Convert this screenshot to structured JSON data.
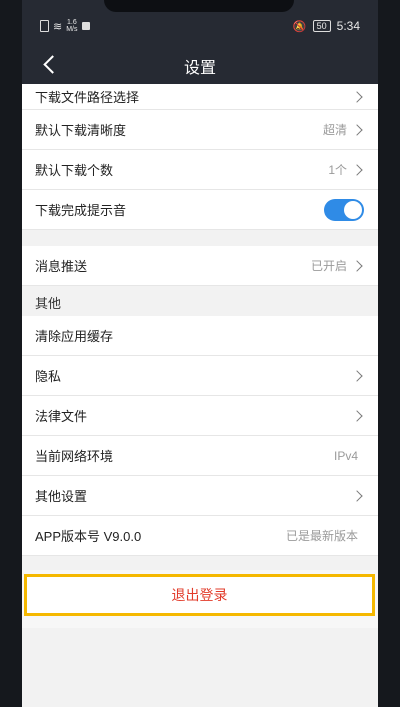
{
  "status": {
    "net_speed_value": "1.6",
    "net_speed_unit": "M/s",
    "battery": "50",
    "time": "5:34"
  },
  "nav": {
    "title": "设置"
  },
  "rows": {
    "download_path": {
      "label": "下载文件路径选择"
    },
    "default_quality": {
      "label": "默认下载清晰度",
      "value": "超清"
    },
    "default_count": {
      "label": "默认下载个数",
      "value": "1个"
    },
    "download_sound": {
      "label": "下载完成提示音",
      "toggle_on": true
    },
    "push": {
      "label": "消息推送",
      "value": "已开启"
    }
  },
  "section_other": {
    "title": "其他"
  },
  "other_rows": {
    "clear_cache": {
      "label": "清除应用缓存"
    },
    "privacy": {
      "label": "隐私"
    },
    "legal": {
      "label": "法律文件"
    },
    "network_env": {
      "label": "当前网络环境",
      "value": "IPv4"
    },
    "other_settings": {
      "label": "其他设置"
    },
    "version": {
      "label": "APP版本号 V9.0.0",
      "value": "已是最新版本"
    }
  },
  "logout": {
    "label": "退出登录"
  },
  "colors": {
    "accent": "#2f8be6",
    "danger": "#e23b2a",
    "highlight": "#f5b800",
    "header": "#262a33"
  }
}
